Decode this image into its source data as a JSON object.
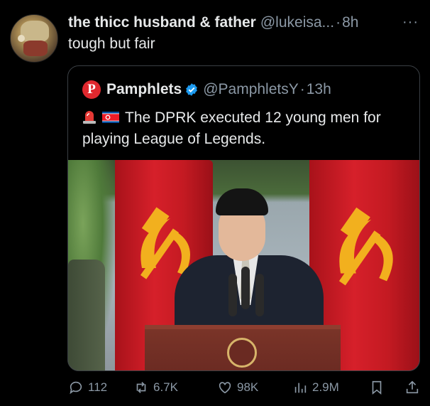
{
  "post": {
    "author_name": "the thicc husband & father",
    "author_handle": "@lukeisa...",
    "separator": "·",
    "time": "8h",
    "more_label": "···",
    "text": "tough but fair"
  },
  "quoted_post": {
    "logo_letter": "P",
    "author_name": "Pamphlets",
    "author_handle": "@PamphletsY",
    "separator": "·",
    "time": "13h",
    "text": "The DPRK executed 12 young men for playing League of Legends."
  },
  "actions": {
    "replies": "112",
    "reposts": "6.7K",
    "likes": "98K",
    "views": "2.9M"
  },
  "icons": [
    "reply-icon",
    "repost-icon",
    "like-icon",
    "views-icon",
    "bookmark-icon",
    "share-icon",
    "verified-icon",
    "siren-icon",
    "north-korea-flag-icon"
  ],
  "colors": {
    "verified": "#1d9bf0",
    "logo": "#e0282e",
    "muted": "#8b98a5"
  }
}
